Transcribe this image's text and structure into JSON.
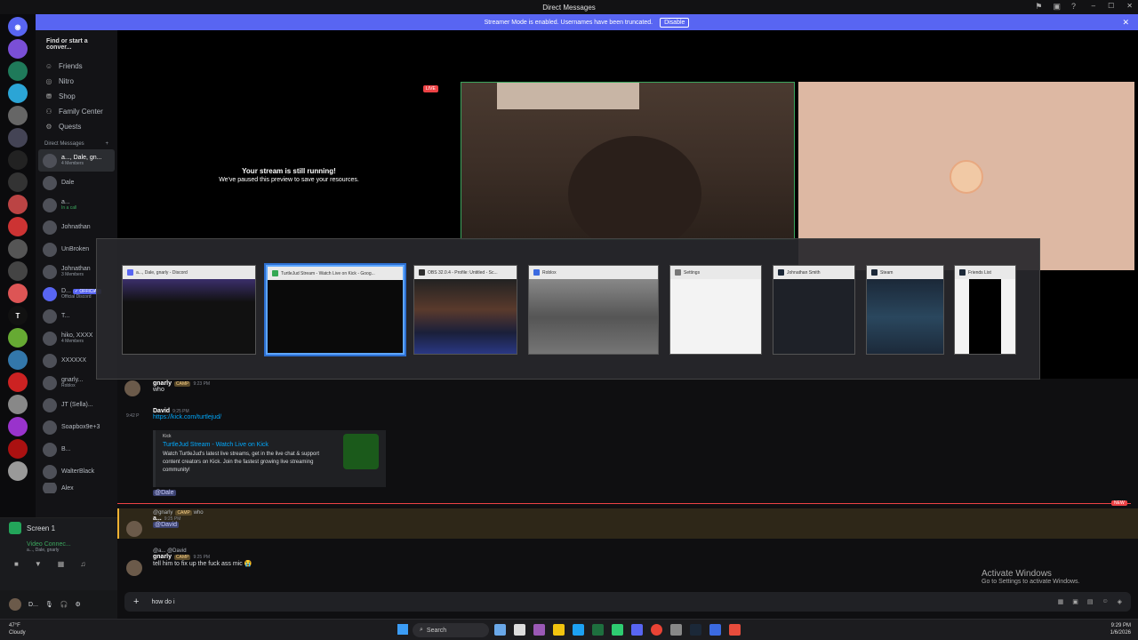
{
  "window": {
    "title": "Direct Messages",
    "controls": [
      "–",
      "☐",
      "✕"
    ]
  },
  "banner": {
    "text": "Streamer Mode is enabled. Usernames have been truncated.",
    "button": "Disable",
    "close": "✕"
  },
  "sidebar": {
    "find": "Find or start a conver...",
    "nav": [
      {
        "label": "Friends",
        "icon": "☺"
      },
      {
        "label": "Nitro",
        "icon": "◎"
      },
      {
        "label": "Shop",
        "icon": "⛃"
      },
      {
        "label": "Family Center",
        "icon": "⚇"
      },
      {
        "label": "Quests",
        "icon": "⚙"
      }
    ],
    "dm_header": "Direct Messages",
    "dm_add": "+",
    "dms": [
      {
        "name": "a..., Dale, gn...",
        "sub": "4 Members"
      },
      {
        "name": "Dale",
        "sub": ""
      },
      {
        "name": "a...",
        "sub": "In a call"
      },
      {
        "name": "Johnathan",
        "sub": ""
      },
      {
        "name": "UnBroken",
        "sub": ""
      },
      {
        "name": "Johnathan",
        "sub": "3 Members"
      },
      {
        "name": "D...",
        "sub": "Official Discord"
      },
      {
        "name": "T...",
        "sub": ""
      },
      {
        "name": "hiko, XXXX",
        "sub": "4 Members"
      },
      {
        "name": "XXXXXX",
        "sub": ""
      },
      {
        "name": "gnarly...",
        "sub": "Roblox"
      },
      {
        "name": "JT (Sella)...",
        "sub": ""
      },
      {
        "name": "Soapbox9e+3",
        "sub": ""
      },
      {
        "name": "B...",
        "sub": ""
      },
      {
        "name": "WalterBlack",
        "sub": ""
      },
      {
        "name": "Alex",
        "sub": ""
      }
    ],
    "official_badge": "✓ OFFICIAL"
  },
  "voice": {
    "screen": "Screen 1",
    "status": "Video Connec...",
    "channel": "a..., Dale, gnarly",
    "user": "D..."
  },
  "stage": {
    "paused_title": "Your stream is still running!",
    "paused_sub": "We've paused this preview to save your resources.",
    "live": "LIVE"
  },
  "alttab": [
    {
      "title": "a..., Dale, gnarly - Discord",
      "color": "#5865f2"
    },
    {
      "title": "TurtleJud Stream - Watch Live on Kick - Goog...",
      "color": "#34a853"
    },
    {
      "title": "OBS 32.0.4 - Profile: Untitled - Sc...",
      "color": "#303030"
    },
    {
      "title": "Roblox",
      "color": "#3b6ae0"
    },
    {
      "title": "Settings",
      "color": "#777777"
    },
    {
      "title": "Johnathan Smith",
      "color": "#1b2838"
    },
    {
      "title": "Steam",
      "color": "#1b2838"
    },
    {
      "title": "Friends List",
      "color": "#1b2838"
    }
  ],
  "chat": {
    "m1": {
      "name": "gnarly",
      "badge": "CAMP",
      "time": "9:23 PM",
      "text": "who"
    },
    "m2": {
      "name": "David",
      "time": "9:25 PM",
      "link": "https://kick.com/turtlejud/",
      "side_time": "9:42 P"
    },
    "embed": {
      "provider": "Kick",
      "title": "TurtleJud Stream - Watch Live on Kick",
      "desc": "Watch TurtleJud's latest live streams, get in the live chat & support content creators on Kick. Join the fastest growing live streaming community!"
    },
    "mention1": "@Dale",
    "new_tag": "NEW",
    "m3": {
      "reply": "@gnarly",
      "badge": "CAMP",
      "reply_text": "who",
      "name": "a...",
      "time": "9:25 PM",
      "mention": "@David"
    },
    "m4": {
      "reply": "@a... @David",
      "name": "gnarly",
      "badge": "CAMP",
      "time": "9:25 PM",
      "text": "tell him to fix up the fuck ass mic 😭"
    }
  },
  "composer": {
    "value": "how do i",
    "add": "+"
  },
  "activate": {
    "title": "Activate Windows",
    "sub": "Go to Settings to activate Windows."
  },
  "taskbar": {
    "search": "Search",
    "weather_temp": "47°F",
    "weather_desc": "Cloudy",
    "time": "9:29 PM",
    "date": "1/6/2026"
  }
}
